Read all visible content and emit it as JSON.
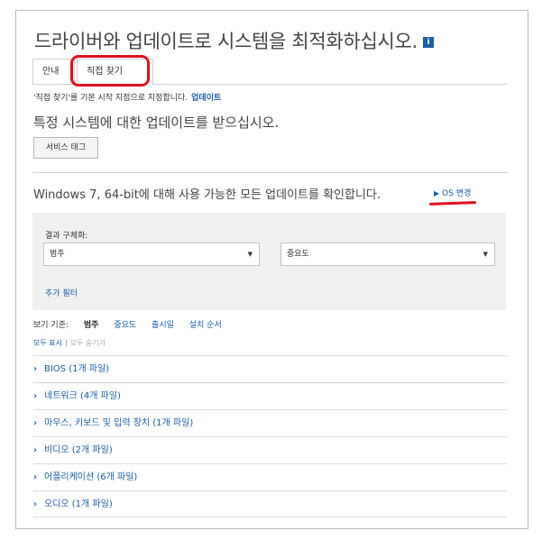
{
  "header": {
    "title": "드라이버와 업데이트로 시스템을 최적화하십시오.",
    "info_icon": "i"
  },
  "tabs": [
    {
      "label": "안내"
    },
    {
      "label": "직접 찾기"
    }
  ],
  "note": {
    "text": "'직접 찾기'를 기본 시작 지점으로 지정합니다.",
    "link": "업데이트"
  },
  "subheading": "특정 시스템에 대한 업데이트를 받으십시오.",
  "service_tag_button": "서비스 태그",
  "os_line": {
    "text": "Windows 7, 64-bit에 대해 사용 가능한 모든 업데이트를 확인합니다.",
    "link": "OS 변경"
  },
  "filters": {
    "label": "결과 구체화:",
    "category_value": "범주",
    "importance_value": "중요도",
    "more_filters": "추가 필터"
  },
  "sort": {
    "label": "보기 기준:",
    "options": [
      "범주",
      "중요도",
      "출시일",
      "설치 순서"
    ]
  },
  "show": {
    "expand_all": "모두 표시",
    "separator": "|",
    "collapse_all": "모두 숨기기"
  },
  "categories": [
    {
      "label": "BIOS (1개 파일)"
    },
    {
      "label": "네트워크 (4개 파일)"
    },
    {
      "label": "마우스, 키보드 및 입력 장치 (1개 파일)"
    },
    {
      "label": "비디오 (2개 파일)"
    },
    {
      "label": "어플리케이션 (6개 파일)"
    },
    {
      "label": "오디오 (1개 파일)"
    }
  ],
  "colors": {
    "link": "#1a5fa8",
    "highlight": "#e0101c",
    "panel": "#f0f0f0"
  }
}
